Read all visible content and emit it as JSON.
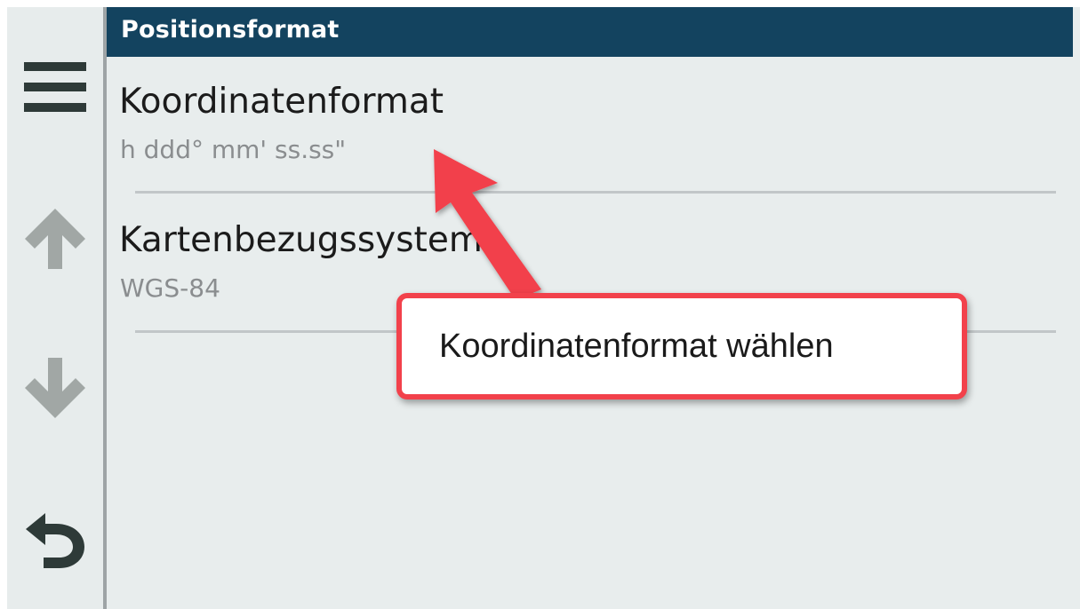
{
  "header": {
    "title": "Positionsformat"
  },
  "sidebar": {
    "buttons": [
      {
        "icon": "menu-icon"
      },
      {
        "icon": "arrow-up-icon"
      },
      {
        "icon": "arrow-down-icon"
      },
      {
        "icon": "back-icon"
      }
    ]
  },
  "settings": [
    {
      "title": "Koordinatenformat",
      "value": "h ddd° mm' ss.ss\""
    },
    {
      "title": "Kartenbezugssystem",
      "value": "WGS-84"
    }
  ],
  "annotation": {
    "callout_text": "Koordinatenformat wählen",
    "color": "#f2414b"
  },
  "colors": {
    "header_bg": "#13435f",
    "panel_bg": "#e8eded",
    "sidebar_icon_dark": "#2e3a38",
    "sidebar_icon_disabled": "#a1a7a5"
  }
}
